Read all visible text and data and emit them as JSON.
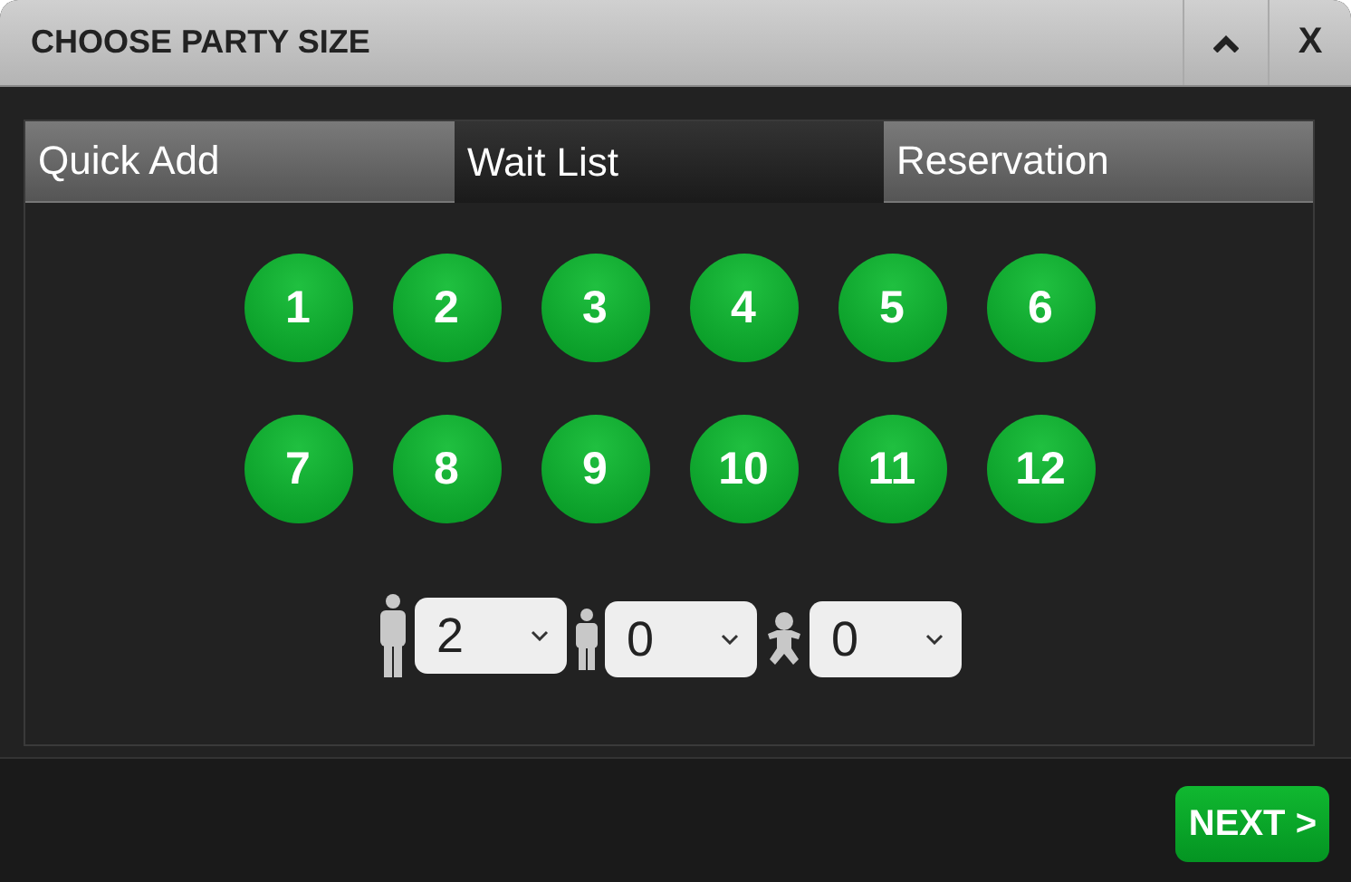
{
  "window": {
    "title": "CHOOSE PARTY SIZE",
    "close_label": "X"
  },
  "tabs": [
    {
      "label": "Quick Add",
      "selected": false
    },
    {
      "label": "Wait List",
      "selected": true
    },
    {
      "label": "Reservation",
      "selected": false
    }
  ],
  "party_sizes": [
    "1",
    "2",
    "3",
    "4",
    "5",
    "6",
    "7",
    "8",
    "9",
    "10",
    "11",
    "12"
  ],
  "guest_counts": [
    {
      "kind": "adult",
      "value": "2"
    },
    {
      "kind": "child",
      "value": "0"
    },
    {
      "kind": "infant",
      "value": "0"
    }
  ],
  "next_button": "NEXT >"
}
